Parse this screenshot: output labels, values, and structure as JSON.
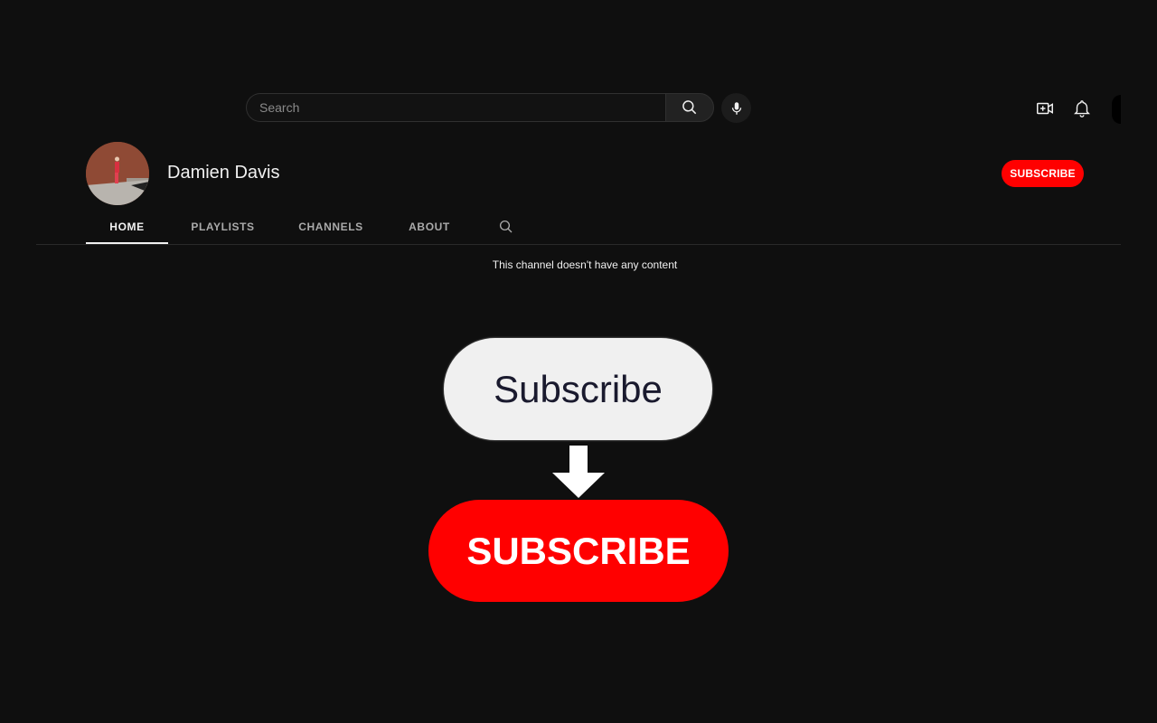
{
  "header": {
    "search": {
      "placeholder": "Search",
      "value": ""
    },
    "icons": [
      "search-icon",
      "microphone-icon",
      "create-video-icon",
      "notifications-bell-icon",
      "account-avatar"
    ]
  },
  "channel": {
    "name": "Damien Davis",
    "subscribe_label": "SUBSCRIBE",
    "accent_color": "#ff0000"
  },
  "tabs": [
    {
      "label": "HOME",
      "active": true
    },
    {
      "label": "PLAYLISTS",
      "active": false
    },
    {
      "label": "CHANNELS",
      "active": false
    },
    {
      "label": "ABOUT",
      "active": false
    }
  ],
  "content": {
    "empty_message": "This channel doesn't have any content"
  },
  "illustration": {
    "before_label": "Subscribe",
    "after_label": "SUBSCRIBE"
  }
}
